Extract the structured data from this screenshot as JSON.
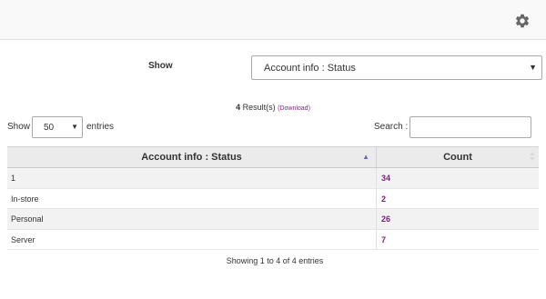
{
  "header": {
    "settings_icon": "gear-icon"
  },
  "filter": {
    "label": "Show",
    "selected": "Account info : Status"
  },
  "results": {
    "count": "4",
    "text": " Result(s) ",
    "download": "(Download)"
  },
  "length_menu": {
    "label_prefix": "Show",
    "selected": "50",
    "label_suffix": "entries"
  },
  "search": {
    "label": "Search :",
    "value": ""
  },
  "table": {
    "columns": [
      "Account info : Status",
      "Count"
    ],
    "rows": [
      {
        "status": "1",
        "count": "34"
      },
      {
        "status": "In-store",
        "count": "2"
      },
      {
        "status": "Personal",
        "count": "26"
      },
      {
        "status": "Server",
        "count": "7"
      }
    ]
  },
  "footer": {
    "info": "Showing 1 to 4 of 4 entries"
  },
  "colors": {
    "accent": "#7b1f7b",
    "sort_active": "#6a6ab0"
  }
}
